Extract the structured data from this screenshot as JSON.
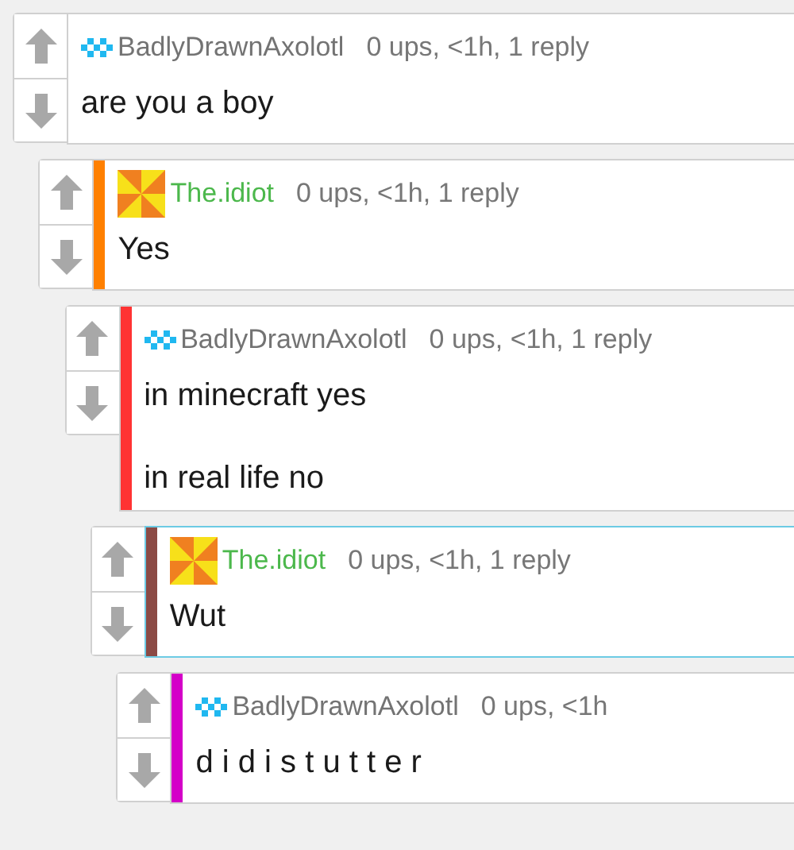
{
  "comments": [
    {
      "user": {
        "name": "BadlyDrawnAxolotl",
        "color": "#737373"
      },
      "avatar": {
        "kind": "pixels"
      },
      "meta": "0 ups, <1h, 1 reply",
      "body": [
        "are you a boy"
      ],
      "selected": false,
      "children": [
        {
          "user": {
            "name": "The.idiot",
            "color": "#4cb84c"
          },
          "avatar": {
            "kind": "pinwheel"
          },
          "color": "#ff8000",
          "meta": "0 ups, <1h, 1 reply",
          "body": [
            "Yes"
          ],
          "selected": false,
          "children": [
            {
              "user": {
                "name": "BadlyDrawnAxolotl",
                "color": "#737373"
              },
              "avatar": {
                "kind": "pixels"
              },
              "color": "#ff3333",
              "meta": "0 ups, <1h, 1 reply",
              "body": [
                "in minecraft yes",
                "in real life no"
              ],
              "selected": false,
              "children": [
                {
                  "user": {
                    "name": "The.idiot",
                    "color": "#4cb84c"
                  },
                  "avatar": {
                    "kind": "pinwheel"
                  },
                  "color": "#8b4a45",
                  "meta": "0 ups, <1h, 1 reply",
                  "body": [
                    "Wut"
                  ],
                  "selected": true,
                  "children": [
                    {
                      "user": {
                        "name": "BadlyDrawnAxolotl",
                        "color": "#737373"
                      },
                      "avatar": {
                        "kind": "pixels"
                      },
                      "color": "#d400c8",
                      "meta": "0 ups, <1h",
                      "body": [
                        "d i d i s t u t t e r"
                      ],
                      "selected": false
                    }
                  ]
                }
              ]
            }
          ]
        }
      ]
    }
  ]
}
